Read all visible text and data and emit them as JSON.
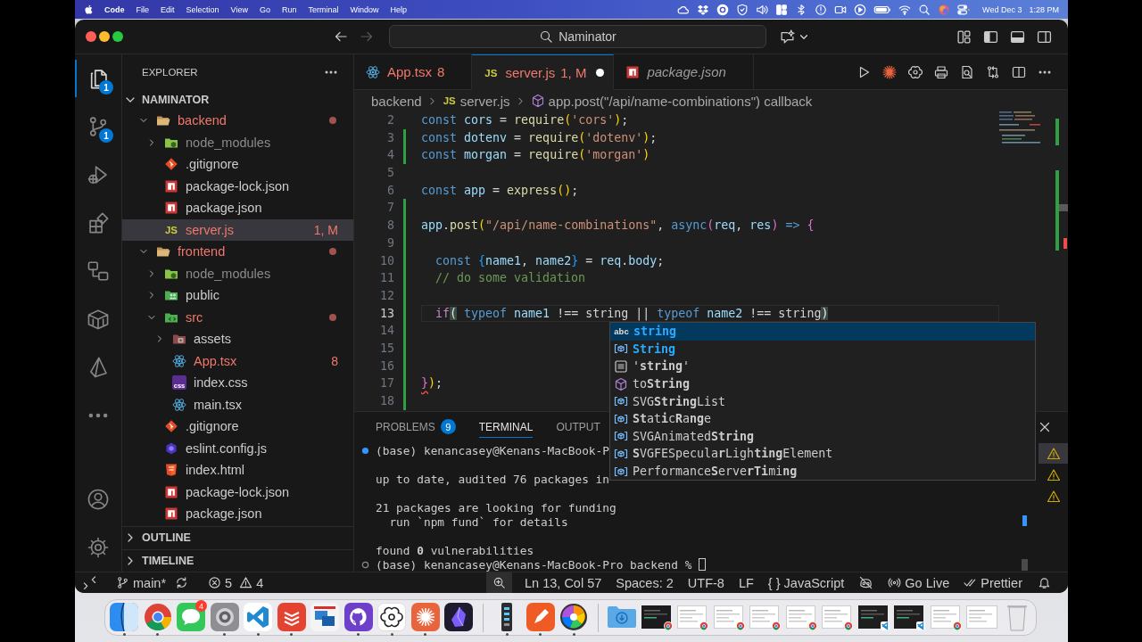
{
  "menu_bar": {
    "app": "Code",
    "menus": [
      "File",
      "Edit",
      "Selection",
      "View",
      "Go",
      "Run",
      "Terminal",
      "Window",
      "Help"
    ],
    "date": "Wed Dec 3",
    "time": "1:28 PM"
  },
  "title_bar": {
    "navigation": [
      {
        "kind": "back",
        "disabled": false
      },
      {
        "kind": "forward",
        "disabled": true
      }
    ],
    "command_center": "Naminator"
  },
  "activity_bar": {
    "items": [
      {
        "kind": "explorer",
        "selected": true,
        "badge": "1"
      },
      {
        "kind": "sourcecontrol",
        "selected": false,
        "badge": "1"
      },
      {
        "kind": "debug",
        "selected": false
      },
      {
        "kind": "extensions",
        "selected": false
      },
      {
        "kind": "remote",
        "selected": false
      },
      {
        "kind": "containers",
        "selected": false
      },
      {
        "kind": "prism",
        "selected": false
      },
      {
        "kind": "more",
        "selected": false
      }
    ],
    "bottom": [
      {
        "kind": "accounts"
      },
      {
        "kind": "settings"
      }
    ]
  },
  "explorer": {
    "title": "EXPLORER",
    "project": {
      "name": "NAMINATOR",
      "expanded": true
    },
    "tree": [
      {
        "name": "backend",
        "kind": "folder",
        "expanded": true,
        "selected": false,
        "problems": true,
        "ignored": false,
        "changed": true,
        "children": [
          {
            "name": "node_modules",
            "kind": "nodefolder",
            "expanded": false,
            "selected": false,
            "problems": false,
            "ignored": true,
            "changed": false
          },
          {
            "name": ".gitignore",
            "kind": "git",
            "selected": false,
            "problems": false,
            "ignored": false,
            "changed": false
          },
          {
            "name": "package-lock.json",
            "kind": "npm",
            "selected": false,
            "problems": false,
            "ignored": false,
            "changed": false
          },
          {
            "name": "package.json",
            "kind": "npm",
            "selected": false,
            "problems": false,
            "ignored": false,
            "changed": false
          },
          {
            "name": "server.js",
            "kind": "js",
            "icon_text": "JS",
            "selected": true,
            "problems": true,
            "ignored": false,
            "changed": false,
            "badge": "1, M"
          }
        ]
      },
      {
        "name": "frontend",
        "kind": "folder",
        "expanded": true,
        "selected": false,
        "problems": true,
        "ignored": false,
        "changed": true,
        "children": [
          {
            "name": "node_modules",
            "kind": "nodefolder",
            "expanded": false,
            "selected": false,
            "problems": false,
            "ignored": true,
            "changed": false
          },
          {
            "name": "public",
            "kind": "publicfolder",
            "expanded": false,
            "selected": false,
            "problems": false,
            "ignored": false,
            "changed": false
          },
          {
            "name": "src",
            "kind": "srcfolder",
            "expanded": true,
            "selected": false,
            "problems": true,
            "ignored": false,
            "changed": true,
            "children": [
              {
                "name": "assets",
                "kind": "assetsfolder",
                "expanded": false,
                "selected": false,
                "problems": false,
                "ignored": false,
                "changed": false
              },
              {
                "name": "App.tsx",
                "kind": "react",
                "selected": false,
                "problems": true,
                "ignored": false,
                "changed": false,
                "badge": "8"
              },
              {
                "name": "index.css",
                "kind": "css",
                "icon_text": "css",
                "selected": false,
                "problems": false,
                "ignored": false,
                "changed": false
              },
              {
                "name": "main.tsx",
                "kind": "react",
                "selected": false,
                "problems": false,
                "ignored": false,
                "changed": false
              }
            ]
          },
          {
            "name": ".gitignore",
            "kind": "git",
            "selected": false,
            "problems": false,
            "ignored": false,
            "changed": false
          },
          {
            "name": "eslint.config.js",
            "kind": "eslint",
            "selected": false,
            "problems": false,
            "ignored": false,
            "changed": false
          },
          {
            "name": "index.html",
            "kind": "html",
            "selected": false,
            "problems": false,
            "ignored": false,
            "changed": false
          },
          {
            "name": "package-lock.json",
            "kind": "npm",
            "selected": false,
            "problems": false,
            "ignored": false,
            "changed": false
          },
          {
            "name": "package.json",
            "kind": "npm",
            "selected": false,
            "problems": false,
            "ignored": false,
            "changed": false
          }
        ]
      }
    ],
    "sections": [
      {
        "name": "OUTLINE",
        "expanded": false
      },
      {
        "name": "TIMELINE",
        "expanded": false
      }
    ]
  },
  "editor": {
    "tabs": [
      {
        "name": "App.tsx",
        "kind": "react",
        "badge": "8",
        "problems": true,
        "selected": false,
        "dirty": false,
        "preview": false
      },
      {
        "name": "server.js",
        "kind": "js",
        "icon_text": "JS",
        "badge": "1, M",
        "problems": true,
        "selected": true,
        "dirty": true,
        "preview": false
      },
      {
        "name": "package.json",
        "kind": "npm",
        "problems": false,
        "selected": false,
        "dirty": false,
        "preview": true
      }
    ],
    "breadcrumbs": [
      {
        "text": "backend",
        "kind": "folder"
      },
      {
        "text": "server.js",
        "kind": "js",
        "icon_text": "JS"
      },
      {
        "text": "app.post(\"/api/name-combinations\") callback",
        "kind": "method"
      }
    ],
    "lines": [
      {
        "number": "2",
        "active": false,
        "added": false,
        "tokens": [
          {
            "text": "const",
            "kind": "kw"
          },
          {
            "text": " cors",
            "kind": "var"
          },
          {
            "text": " = ",
            "kind": "plain"
          },
          {
            "text": "require",
            "kind": "fn"
          },
          {
            "text": "(",
            "kind": "bracket1"
          },
          {
            "text": "'cors'",
            "kind": "str"
          },
          {
            "text": ")",
            "kind": "bracket1"
          },
          {
            "text": ";",
            "kind": "plain"
          }
        ]
      },
      {
        "number": "3",
        "active": false,
        "added": true,
        "tokens": [
          {
            "text": "const",
            "kind": "kw"
          },
          {
            "text": " dotenv",
            "kind": "var"
          },
          {
            "text": " = ",
            "kind": "plain"
          },
          {
            "text": "require",
            "kind": "fn"
          },
          {
            "text": "(",
            "kind": "bracket1"
          },
          {
            "text": "'dotenv'",
            "kind": "str"
          },
          {
            "text": ")",
            "kind": "bracket1"
          },
          {
            "text": ";",
            "kind": "plain"
          }
        ]
      },
      {
        "number": "4",
        "active": false,
        "added": true,
        "tokens": [
          {
            "text": "const",
            "kind": "kw"
          },
          {
            "text": " morgan",
            "kind": "var"
          },
          {
            "text": " = ",
            "kind": "plain"
          },
          {
            "text": "require",
            "kind": "fn"
          },
          {
            "text": "(",
            "kind": "bracket1"
          },
          {
            "text": "'morgan'",
            "kind": "str"
          },
          {
            "text": ")",
            "kind": "bracket1"
          }
        ]
      },
      {
        "number": "5",
        "active": false,
        "added": false
      },
      {
        "number": "6",
        "active": false,
        "added": false,
        "tokens": [
          {
            "text": "const",
            "kind": "kw"
          },
          {
            "text": " app",
            "kind": "var"
          },
          {
            "text": " = ",
            "kind": "plain"
          },
          {
            "text": "express",
            "kind": "fn"
          },
          {
            "text": "()",
            "kind": "bracket1"
          },
          {
            "text": ";",
            "kind": "plain"
          }
        ]
      },
      {
        "number": "7",
        "active": false,
        "added": true
      },
      {
        "number": "8",
        "active": false,
        "added": true,
        "tokens": [
          {
            "text": "app",
            "kind": "var"
          },
          {
            "text": ".",
            "kind": "plain"
          },
          {
            "text": "post",
            "kind": "fn"
          },
          {
            "text": "(",
            "kind": "bracket1"
          },
          {
            "text": "\"/api/name-combinations\"",
            "kind": "str"
          },
          {
            "text": ", ",
            "kind": "plain"
          },
          {
            "text": "async",
            "kind": "kw"
          },
          {
            "text": "(",
            "kind": "bracket2"
          },
          {
            "text": "req",
            "kind": "var"
          },
          {
            "text": ", ",
            "kind": "plain"
          },
          {
            "text": "res",
            "kind": "var"
          },
          {
            "text": ")",
            "kind": "bracket2"
          },
          {
            "text": " =>",
            "kind": "kw"
          },
          {
            "text": " {",
            "kind": "bracket2"
          }
        ]
      },
      {
        "number": "9",
        "active": false,
        "added": true
      },
      {
        "number": "10",
        "active": false,
        "added": true,
        "tokens": [
          {
            "text": "  const",
            "kind": "kw"
          },
          {
            "text": " {",
            "kind": "bracket3"
          },
          {
            "text": "name1",
            "kind": "var"
          },
          {
            "text": ", ",
            "kind": "plain"
          },
          {
            "text": "name2",
            "kind": "var"
          },
          {
            "text": "}",
            "kind": "bracket3"
          },
          {
            "text": " = ",
            "kind": "plain"
          },
          {
            "text": "req",
            "kind": "var"
          },
          {
            "text": ".",
            "kind": "plain"
          },
          {
            "text": "body",
            "kind": "var"
          },
          {
            "text": ";",
            "kind": "plain"
          }
        ]
      },
      {
        "number": "11",
        "active": false,
        "added": true,
        "tokens": [
          {
            "text": "  // do some validation",
            "kind": "comment"
          }
        ]
      },
      {
        "number": "12",
        "active": false,
        "added": true
      },
      {
        "number": "13",
        "active": true,
        "added": true,
        "tokens": [
          {
            "text": "  if",
            "kind": "ctrl"
          },
          {
            "text": "(",
            "kind": "match"
          },
          {
            "text": " typeof",
            "kind": "kw"
          },
          {
            "text": " name1",
            "kind": "var"
          },
          {
            "text": " !== string || ",
            "kind": "plain"
          },
          {
            "text": "typeof",
            "kind": "kw"
          },
          {
            "text": " name2",
            "kind": "var"
          },
          {
            "text": " !== string",
            "kind": "plain"
          },
          {
            "text": ")",
            "kind": "match"
          }
        ]
      },
      {
        "number": "14",
        "active": false,
        "added": true
      },
      {
        "number": "15",
        "active": false,
        "added": true
      },
      {
        "number": "16",
        "active": false,
        "added": true
      },
      {
        "number": "17",
        "active": false,
        "added": true,
        "tokens": [
          {
            "text": "}",
            "kind": "squiggle"
          },
          {
            "text": ")",
            "kind": "bracket1"
          },
          {
            "text": ";",
            "kind": "plain"
          }
        ]
      },
      {
        "number": "18",
        "active": false,
        "added": true
      }
    ],
    "suggestions": [
      {
        "label": "string",
        "kind": "text",
        "icon_text": "abc",
        "matched": true,
        "selected": true
      },
      {
        "label": "String",
        "kind": "variable",
        "matched": true,
        "selected": false
      },
      {
        "label": "'**string**'",
        "kind": "value",
        "matched": false,
        "selected": false
      },
      {
        "label": "to**String**",
        "kind": "method",
        "matched": false,
        "selected": false
      },
      {
        "label": "SVG**String**List",
        "kind": "variable",
        "matched": false,
        "selected": false
      },
      {
        "label": "**St**at**i**c**R**a**ng**e",
        "kind": "variable",
        "matched": false,
        "selected": false
      },
      {
        "label": "SVGAnimated**String**",
        "kind": "variable",
        "matched": false,
        "selected": false
      },
      {
        "label": "**S**VGFESpecula**r**Ligh**ting**Element",
        "kind": "variable",
        "matched": false,
        "selected": false
      },
      {
        "label": "Performance**S**erve**rTi**mi**ng**",
        "kind": "variable",
        "matched": false,
        "selected": false
      }
    ]
  },
  "panel": {
    "tabs": [
      {
        "label": "PROBLEMS",
        "badge": "9",
        "selected": false
      },
      {
        "label": "TERMINAL",
        "selected": true
      },
      {
        "label": "OUTPUT",
        "selected": false
      }
    ],
    "terminal": [
      {
        "lines": [
          {
            "kind": "success",
            "text": "(base) kenancasey@Kenans-MacBook-P",
            "cursor": false
          }
        ]
      },
      {
        "lines": [
          {
            "kind": "output",
            "text": "up to date, audited 76 packages in",
            "cursor": false
          }
        ]
      },
      {
        "lines": [
          {
            "kind": "output",
            "text": "21 packages are looking for funding",
            "cursor": false
          },
          {
            "kind": "output",
            "text": "  run `npm fund` for details",
            "cursor": false
          }
        ]
      },
      {
        "lines": [
          {
            "kind": "output",
            "text": "found **0** vulnerabilities",
            "cursor": false
          },
          {
            "kind": "prompt",
            "text": "(base) kenancasey@Kenans-MacBook-Pro backend %",
            "cursor": true
          }
        ]
      }
    ],
    "instances": [
      {
        "kind": "warning",
        "selected": true
      },
      {
        "kind": "warning",
        "selected": false
      },
      {
        "kind": "warning",
        "selected": false
      }
    ]
  },
  "status_bar": {
    "branch": "main*",
    "errors": "5",
    "warnings": "4",
    "items": [
      {
        "kind": "zoom"
      },
      {
        "kind": "text",
        "text": "Ln 13, Col 57"
      },
      {
        "kind": "text",
        "text": "Spaces: 2"
      },
      {
        "kind": "text",
        "text": "UTF-8"
      },
      {
        "kind": "text",
        "text": "LF"
      },
      {
        "kind": "text",
        "text": "{ } JavaScript"
      },
      {
        "kind": "mask"
      },
      {
        "kind": "live",
        "text": "Go Live"
      },
      {
        "kind": "prettier",
        "text": "Prettier"
      },
      {
        "kind": "bell"
      }
    ]
  },
  "dock": {
    "apps": [
      {
        "kind": "finder",
        "running": true
      },
      {
        "kind": "browser",
        "running": true
      },
      {
        "kind": "messages",
        "running": false,
        "badge": "4"
      },
      {
        "kind": "settings",
        "running": true
      },
      {
        "kind": "editor",
        "running": true
      },
      {
        "kind": "todo",
        "running": true
      },
      {
        "kind": "screens",
        "running": false
      },
      {
        "kind": "cat",
        "running": true
      },
      {
        "kind": "knot",
        "running": true
      },
      {
        "kind": "burst",
        "running": true
      },
      {
        "kind": "crystal",
        "running": false
      }
    ],
    "utilities": [
      {
        "kind": "meter",
        "running": true
      },
      {
        "kind": "pen",
        "running": true
      },
      {
        "kind": "wheel",
        "running": true
      }
    ],
    "stack": [
      {
        "kind": "folder"
      },
      {
        "kind": "darkwindow"
      },
      {
        "kind": "browserwindow"
      },
      {
        "kind": "browserwindow"
      },
      {
        "kind": "browserwindow"
      },
      {
        "kind": "browserwindow"
      },
      {
        "kind": "browserwindow"
      },
      {
        "kind": "editorwindow"
      },
      {
        "kind": "editorwindow"
      },
      {
        "kind": "browserwindow"
      },
      {
        "kind": "plainwindow"
      },
      {
        "kind": "trash"
      }
    ]
  }
}
